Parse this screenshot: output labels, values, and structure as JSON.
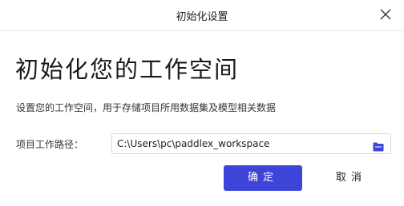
{
  "window": {
    "title": "初始化设置",
    "close_icon": "close-icon"
  },
  "main": {
    "heading": "初始化您的工作空间",
    "description": "设置您的工作空间，用于存储项目所用数据集及模型相关数据",
    "path_label": "项目工作路径：",
    "path_value": "C:\\Users\\pc\\paddlex_workspace",
    "folder_icon": "folder-icon"
  },
  "buttons": {
    "ok_label": "确定",
    "cancel_label": "取消"
  },
  "colors": {
    "primary": "#3d45d9",
    "folder_icon": "#3d45d9"
  }
}
